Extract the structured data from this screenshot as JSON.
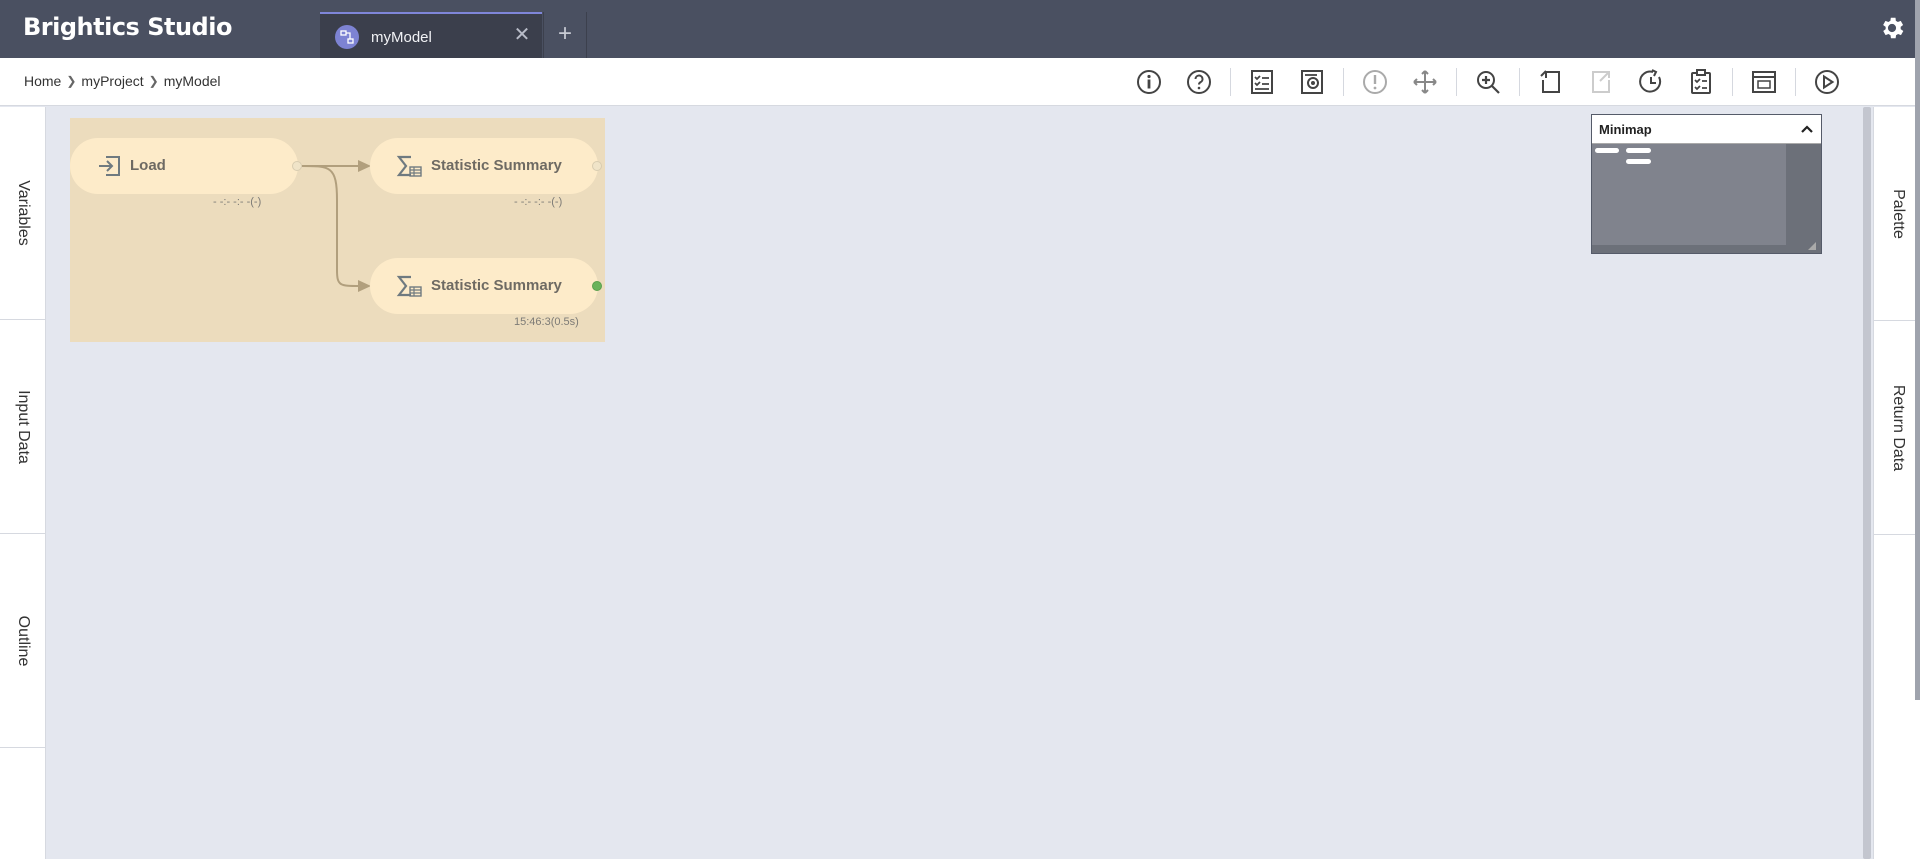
{
  "app": {
    "title": "Brightics Studio"
  },
  "tabs": [
    {
      "label": "myModel"
    }
  ],
  "breadcrumb": [
    "Home",
    "myProject",
    "myModel"
  ],
  "toolbar": {
    "buttons": [
      "info-icon",
      "help-icon",
      "report-icon",
      "preview-icon",
      "validate-icon",
      "pan-icon",
      "zoom-icon",
      "undo-icon",
      "redo-icon",
      "history-icon",
      "checklist-icon",
      "layout-icon",
      "run-icon"
    ]
  },
  "left_panel": {
    "tabs": [
      "Variables",
      "Input Data",
      "Outline"
    ]
  },
  "right_panel": {
    "tabs": [
      "Palette",
      "Return Data"
    ]
  },
  "workflow": {
    "nodes": [
      {
        "label": "Load",
        "status": "- -:- -:- -(-)"
      },
      {
        "label": "Statistic Summary",
        "status": "- -:- -:- -(-)"
      },
      {
        "label": "Statistic Summary",
        "status": "15:46:3(0.5s)"
      }
    ],
    "colors": {
      "group_bg": "#ecdcbd",
      "node_bg": "#fdebc9",
      "success_port": "#6ab35b"
    }
  },
  "minimap": {
    "title": "Minimap"
  },
  "colors": {
    "header_bg": "#4a5061",
    "tab_active_bg": "#3b3f4c",
    "accent": "#7d83d3",
    "canvas_bg": "#e4e7ef"
  }
}
